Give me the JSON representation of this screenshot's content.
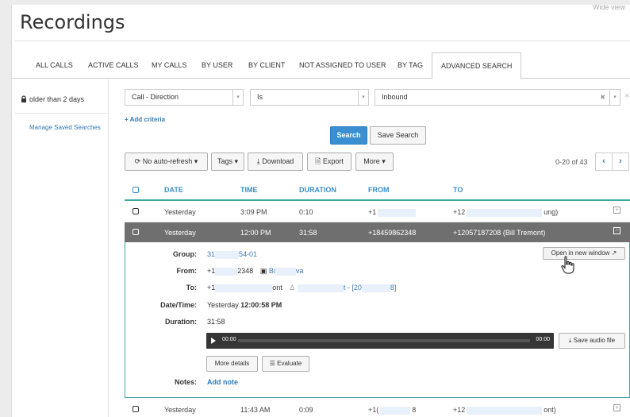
{
  "header": {
    "title": "Recordings",
    "wide_view": "Wide view"
  },
  "tabs": [
    {
      "label": "ALL CALLS"
    },
    {
      "label": "ACTIVE CALLS"
    },
    {
      "label": "MY CALLS"
    },
    {
      "label": "BY USER"
    },
    {
      "label": "BY CLIENT"
    },
    {
      "label": "NOT ASSIGNED TO USER"
    },
    {
      "label": "BY TAG"
    },
    {
      "label": "ADVANCED SEARCH"
    }
  ],
  "sidebar": {
    "filter_label": "older than 2 days",
    "manage_link": "Manage Saved Searches"
  },
  "criteria": {
    "field": "Call - Direction",
    "operator": "Is",
    "value": "Inbound",
    "add_label": "+ Add criteria",
    "search_label": "Search",
    "save_search_label": "Save Search"
  },
  "toolbar": {
    "auto_refresh": "No auto-refresh",
    "tags": "Tags",
    "download": "Download",
    "export": "Export",
    "more": "More"
  },
  "pager": {
    "text": "0-20 of 43",
    "prev": "‹",
    "next": "›"
  },
  "table": {
    "columns": [
      "DATE",
      "TIME",
      "DURATION",
      "FROM",
      "TO"
    ],
    "rows": [
      {
        "date": "Yesterday",
        "time": "3:09 PM",
        "duration": "0:10",
        "from": "+1",
        "to": "+12",
        "to_suffix": "ung)"
      },
      {
        "date": "Yesterday",
        "time": "12:00 PM",
        "duration": "31:58",
        "from": "+18459862348",
        "to": "+12057187208 (Bill Tremont)"
      },
      {
        "date": "Yesterday",
        "time": "11:43 AM",
        "duration": "0:09",
        "from": "+1(",
        "from_suffix": "8",
        "to": "+12",
        "to_suffix": "ont)"
      }
    ]
  },
  "details": {
    "open_new_window": "Open in new window",
    "group_label": "Group:",
    "group_value_a": "31",
    "group_value_b": "54-01",
    "from_label": "From:",
    "from_value_a": "+1",
    "from_value_b": "2348",
    "from_contact_a": "Bi",
    "from_contact_b": "va",
    "to_label": "To:",
    "to_value_a": "+1",
    "to_value_b": "ont",
    "to_contact_a": "t - [20",
    "to_contact_b": "8]",
    "datetime_label": "Date/Time:",
    "datetime_day": "Yesterday",
    "datetime_time": "12:00:58 PM",
    "duration_label": "Duration:",
    "duration_value": "31:58",
    "player_start": "00:00",
    "player_end": "00:00",
    "save_audio": "Save audio file",
    "more_details": "More details",
    "evaluate": "Evaluate",
    "notes_label": "Notes:",
    "add_note": "Add note"
  },
  "colors": {
    "accent": "#337ab7",
    "primary_button": "#3b8fd0",
    "selected_row": "#6f6f6f",
    "teal_rule": "#39a9a0"
  }
}
